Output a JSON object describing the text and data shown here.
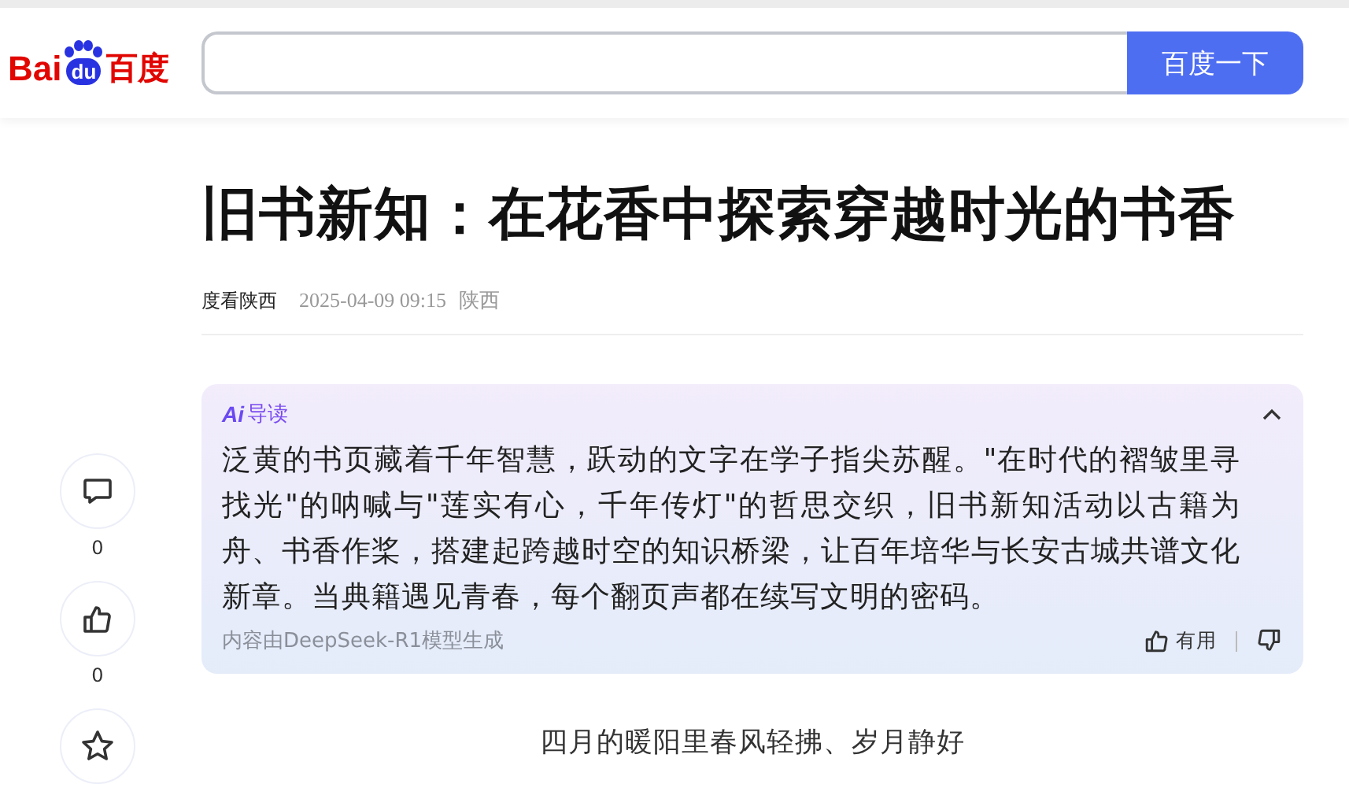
{
  "logo": {
    "left": "Bai",
    "mark": "du",
    "right": "百度"
  },
  "search": {
    "button": "百度一下"
  },
  "article": {
    "title": "旧书新知：在花香中探索穿越时光的书香",
    "author": "度看陕西",
    "date": "2025-04-09 09:15",
    "region": "陕西"
  },
  "ai_summary": {
    "badge": "Ai",
    "label": "导读",
    "expanded": true,
    "text": "泛黄的书页藏着千年智慧，跃动的文字在学子指尖苏醒。\"在时代的褶皱里寻找光\"的呐喊与\"莲实有心，千年传灯\"的哲思交织，旧书新知活动以古籍为舟、书香作桨，搭建起跨越时空的知识桥梁，让百年培华与长安古城共谱文化新章。当典籍遇见青春，每个翻页声都在续写文明的密码。",
    "source": "内容由DeepSeek-R1模型生成",
    "useful": "有用"
  },
  "actions": [
    {
      "kind": "comment",
      "count": "0"
    },
    {
      "kind": "like",
      "count": "0"
    },
    {
      "kind": "favorite"
    }
  ],
  "subtitle": "四月的暖阳里春风轻拂、岁月静好"
}
